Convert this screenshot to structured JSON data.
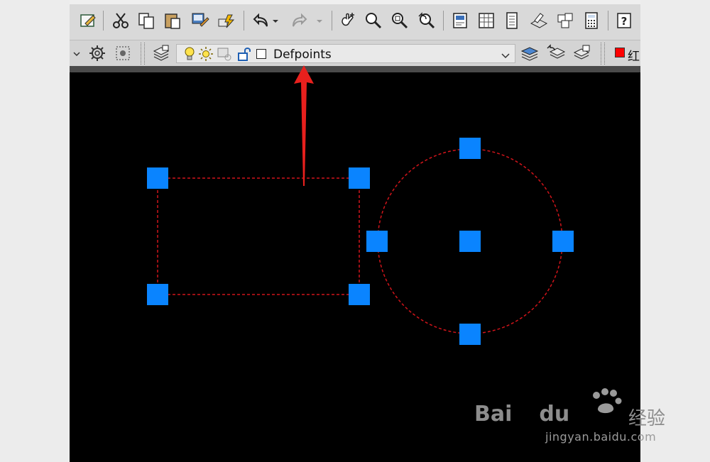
{
  "toolbar_top": {
    "buttons": [
      "edit-icon",
      "cut-icon",
      "copy-icon",
      "paste-icon",
      "match-properties-icon",
      "block-editor-icon",
      "undo-icon",
      "undo-dropdown-icon",
      "redo-icon",
      "redo-dropdown-icon",
      "pan-icon",
      "zoom-realtime-icon",
      "zoom-window-icon",
      "zoom-previous-icon",
      "properties-icon",
      "design-center-icon",
      "tool-palettes-icon",
      "markup-icon",
      "sheet-set-icon",
      "calculator-icon",
      "help-icon"
    ]
  },
  "layers_toolbar": {
    "current_layer": "Defpoints",
    "layer_state": {
      "on": true,
      "thawed": true,
      "unlocked": true
    },
    "color_label": "红",
    "color_swatch": "#ff0000"
  },
  "canvas": {
    "background": "#000000",
    "object_linetype_color": "#d0141a",
    "grip_color": "#0a84ff"
  },
  "annotation": {
    "arrow_color": "#e8201d"
  },
  "watermark": {
    "brand": "Bai",
    "brand2": "du",
    "label_cn": "经验",
    "url": "jingyan.baidu.com"
  }
}
